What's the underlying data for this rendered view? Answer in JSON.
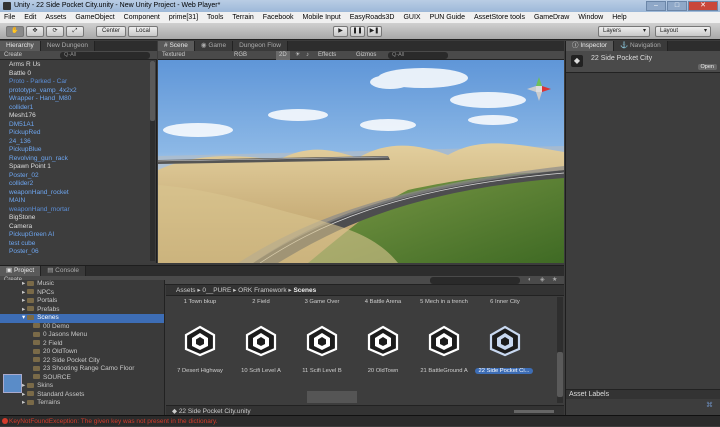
{
  "window": {
    "title": "Unity - 22 Side Pocket City.unity - New Unity Project - Web Player*"
  },
  "menu": [
    "File",
    "Edit",
    "Assets",
    "GameObject",
    "Component",
    "prime[31]",
    "Tools",
    "Terrain",
    "Facebook",
    "Mobile Input",
    "EasyRoads3D",
    "GUIX",
    "PUN Guide",
    "AssetStore tools",
    "GameDraw",
    "Window",
    "Help"
  ],
  "toolbar": {
    "pivot": "Center",
    "space": "Local",
    "layers": "Layers",
    "layout": "Layout"
  },
  "hierarchy": {
    "tabs": [
      "Hierarchy",
      "New Dungeon"
    ],
    "create": "Create",
    "search": "Q-All",
    "items": [
      {
        "label": "Arms R Us",
        "color": "white"
      },
      {
        "label": "Battle 0",
        "color": "white"
      },
      {
        "label": "Proto - Parked - Car",
        "color": "hl"
      },
      {
        "label": "prototype_vamp_4x2x2",
        "color": "blue"
      },
      {
        "label": "Wrapper - Hand_M80",
        "color": "blue"
      },
      {
        "label": "collider1",
        "color": "blue"
      },
      {
        "label": "Mesh176",
        "color": "white"
      },
      {
        "label": "DM51A1",
        "color": "blue"
      },
      {
        "label": "PickupRed",
        "color": "blue"
      },
      {
        "label": "24_136",
        "color": "blue"
      },
      {
        "label": "PickupBlue",
        "color": "blue"
      },
      {
        "label": "Revolving_gun_rack",
        "color": "blue"
      },
      {
        "label": "Spawn Point 1",
        "color": "white"
      },
      {
        "label": "Poster_02",
        "color": "blue"
      },
      {
        "label": "collider2",
        "color": "blue"
      },
      {
        "label": "weaponHand_rocket",
        "color": "blue"
      },
      {
        "label": "MAIN",
        "color": "blue"
      },
      {
        "label": "weaponHand_mortar",
        "color": "hl"
      },
      {
        "label": "BigStone",
        "color": "white"
      },
      {
        "label": "Camera",
        "color": "white"
      },
      {
        "label": "PickupGreen AI",
        "color": "blue"
      },
      {
        "label": "test cube",
        "color": "blue"
      },
      {
        "label": "Poster_06",
        "color": "blue"
      }
    ]
  },
  "scene": {
    "tabs": [
      "Scene",
      "Game",
      "Dungeon Flow"
    ],
    "render_mode": "Textured",
    "channel": "RGB",
    "mode_2d": "2D",
    "effects": "Effects",
    "gizmos": "Gizmos",
    "search": "Q-All"
  },
  "inspector": {
    "tabs": [
      "Inspector",
      "Navigation"
    ],
    "object_name": "22 Side Pocket City",
    "open": "Open",
    "asset_labels": "Asset Labels"
  },
  "project": {
    "tabs": [
      "Project",
      "Console"
    ],
    "create": "Create",
    "tree": [
      {
        "label": "Music",
        "indent": 2
      },
      {
        "label": "NPCs",
        "indent": 2
      },
      {
        "label": "Portals",
        "indent": 2
      },
      {
        "label": "Prefabs",
        "indent": 2
      },
      {
        "label": "Scenes",
        "indent": 2,
        "selected": true
      },
      {
        "label": "00 Demo",
        "indent": 3
      },
      {
        "label": "0 Jasons Menu",
        "indent": 3
      },
      {
        "label": "2 Field",
        "indent": 3
      },
      {
        "label": "20 OldTown",
        "indent": 3
      },
      {
        "label": "22 Side Pocket City",
        "indent": 3
      },
      {
        "label": "23 Shooting Range Camo Floor",
        "indent": 3
      },
      {
        "label": "SOURCE",
        "indent": 3
      },
      {
        "label": "Skins",
        "indent": 2
      },
      {
        "label": "Standard Assets",
        "indent": 2
      },
      {
        "label": "Terrains",
        "indent": 2
      }
    ],
    "breadcrumb": [
      "Assets",
      "0__PURE",
      "ORK Framework",
      "Scenes"
    ],
    "top_labels": [
      "1 Town bkup",
      "2 Field",
      "3 Game Over",
      "4 Battle Arena",
      "5 Mech in a trench",
      "6 Inner City"
    ],
    "bottom_labels": [
      "7 Desert Highway",
      "10 Scifi Level A",
      "11 Scifi Level B",
      "20 OldTown",
      "21 BattleGround A",
      "22 Side Pocket Ci..."
    ],
    "footer_path": "22 Side Pocket City.unity"
  },
  "status": {
    "error": "KeyNotFoundException: The given key was not present in the dictionary."
  },
  "colors": {
    "accent": "#3d6db5",
    "error": "#d23b2b",
    "hier_blue": "#6ea6f0"
  }
}
